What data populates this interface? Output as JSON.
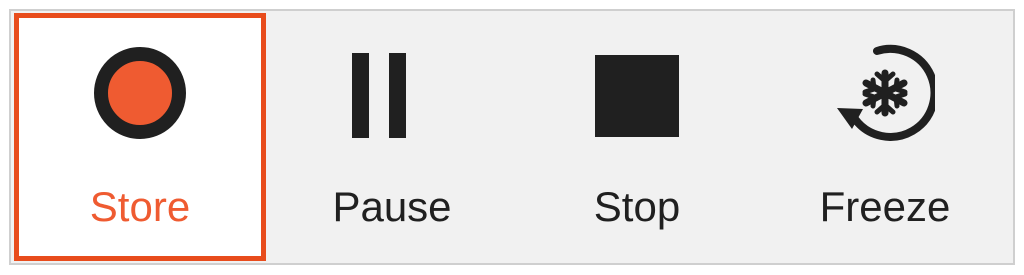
{
  "toolbar": {
    "items": [
      {
        "label": "Store",
        "icon": "record-circle-icon",
        "selected": true
      },
      {
        "label": "Pause",
        "icon": "pause-icon",
        "selected": false
      },
      {
        "label": "Stop",
        "icon": "stop-square-icon",
        "selected": false
      },
      {
        "label": "Freeze",
        "icon": "freeze-cycle-icon",
        "selected": false
      }
    ]
  },
  "colors": {
    "accent": "#e84c1c",
    "record_fill": "#ef5b31",
    "icon_dark": "#202020",
    "toolbar_bg": "#f1f1f1",
    "selected_bg": "#ffffff",
    "border": "#cfcfcf"
  }
}
